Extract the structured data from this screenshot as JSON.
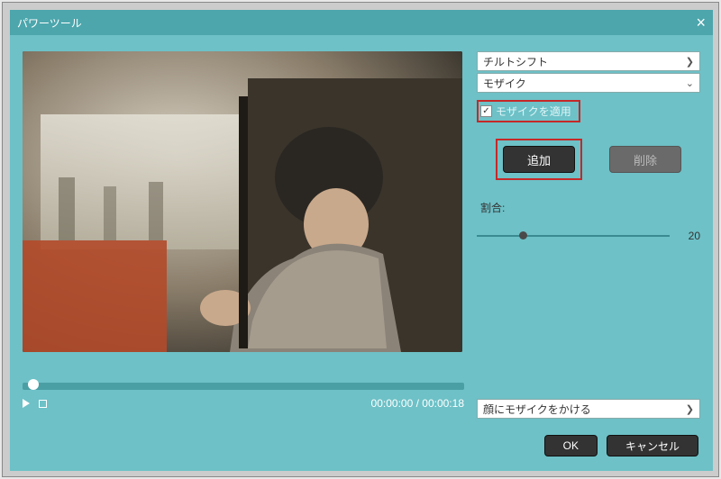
{
  "window": {
    "title": "パワーツール"
  },
  "preview": {
    "time_current": "00:00:00",
    "time_total": "00:00:18"
  },
  "panel": {
    "combo1": {
      "label": "チルトシフト"
    },
    "combo2": {
      "label": "モザイク"
    },
    "apply_mosaic_label": "モザイクを適用",
    "apply_mosaic_checked": true,
    "add_label": "追加",
    "delete_label": "削除",
    "ratio_label": "割合:",
    "ratio_value": "20",
    "face_combo": {
      "label": "顔にモザイクをかける"
    }
  },
  "footer": {
    "ok": "OK",
    "cancel": "キャンセル"
  }
}
